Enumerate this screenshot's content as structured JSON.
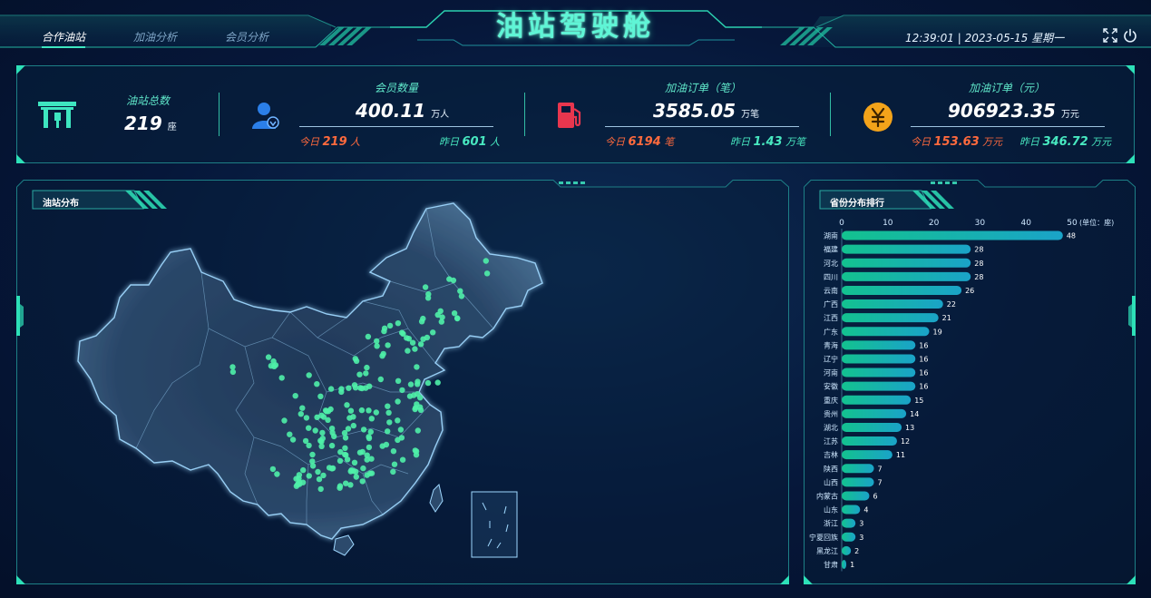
{
  "header": {
    "title": "油站驾驶舱",
    "tabs": [
      {
        "label": "合作油站",
        "active": true
      },
      {
        "label": "加油分析",
        "active": false
      },
      {
        "label": "会员分析",
        "active": false
      }
    ],
    "datetime": "12:39:01 | 2023-05-15 星期一",
    "icons": [
      "fullscreen-icon",
      "power-icon"
    ]
  },
  "stats": {
    "stations": {
      "label": "油站总数",
      "value": "219",
      "unit": "座",
      "icon": "gas-station-icon"
    },
    "members": {
      "label": "会员数量",
      "value": "400.11",
      "unit": "万人",
      "today_label": "今日",
      "today_value": "219",
      "today_unit": "人",
      "yesterday_label": "昨日",
      "yesterday_value": "601",
      "yesterday_unit": "人",
      "icon": "member-icon"
    },
    "orders_count": {
      "label": "加油订单（笔）",
      "value": "3585.05",
      "unit": "万笔",
      "today_label": "今日",
      "today_value": "6194",
      "today_unit": "笔",
      "yesterday_label": "昨日",
      "yesterday_value": "1.43",
      "yesterday_unit": "万笔",
      "icon": "fuel-pump-icon"
    },
    "orders_amount": {
      "label": "加油订单（元）",
      "value": "906923.35",
      "unit": "万元",
      "today_label": "今日",
      "today_value": "153.63",
      "today_unit": "万元",
      "yesterday_label": "昨日",
      "yesterday_value": "346.72",
      "yesterday_unit": "万元",
      "icon": "yuan-icon"
    }
  },
  "map_panel": {
    "title": "油站分布"
  },
  "rank_panel": {
    "title": "省份分布排行",
    "unit_label": "(单位：座)"
  },
  "colors": {
    "accent": "#3ee6c0",
    "today": "#ff6a3d",
    "bar_start": "#13c28f",
    "bar_end": "#1aa3c8",
    "marker": "#4ff0a8"
  },
  "chart_data": {
    "type": "bar",
    "orientation": "horizontal",
    "categories": [
      "湖南",
      "福建",
      "河北",
      "四川",
      "云南",
      "广西",
      "江西",
      "广东",
      "青海",
      "辽宁",
      "河南",
      "安徽",
      "重庆",
      "贵州",
      "湖北",
      "江苏",
      "吉林",
      "陕西",
      "山西",
      "内蒙古",
      "山东",
      "浙江",
      "宁夏回族",
      "黑龙江",
      "甘肃"
    ],
    "values": [
      48,
      28,
      28,
      28,
      26,
      22,
      21,
      19,
      16,
      16,
      16,
      16,
      15,
      14,
      13,
      12,
      11,
      7,
      7,
      6,
      4,
      3,
      3,
      2,
      1
    ],
    "xlim": [
      0,
      50
    ],
    "xticks": [
      0,
      10,
      20,
      30,
      40,
      50
    ],
    "unit": "(单位：座)"
  }
}
